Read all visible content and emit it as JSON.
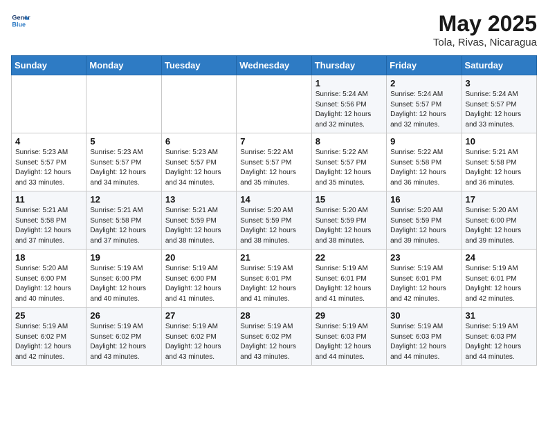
{
  "header": {
    "logo_line1": "General",
    "logo_line2": "Blue",
    "month": "May 2025",
    "location": "Tola, Rivas, Nicaragua"
  },
  "days_of_week": [
    "Sunday",
    "Monday",
    "Tuesday",
    "Wednesday",
    "Thursday",
    "Friday",
    "Saturday"
  ],
  "weeks": [
    [
      {
        "day": "",
        "info": ""
      },
      {
        "day": "",
        "info": ""
      },
      {
        "day": "",
        "info": ""
      },
      {
        "day": "",
        "info": ""
      },
      {
        "day": "1",
        "info": "Sunrise: 5:24 AM\nSunset: 5:56 PM\nDaylight: 12 hours\nand 32 minutes."
      },
      {
        "day": "2",
        "info": "Sunrise: 5:24 AM\nSunset: 5:57 PM\nDaylight: 12 hours\nand 32 minutes."
      },
      {
        "day": "3",
        "info": "Sunrise: 5:24 AM\nSunset: 5:57 PM\nDaylight: 12 hours\nand 33 minutes."
      }
    ],
    [
      {
        "day": "4",
        "info": "Sunrise: 5:23 AM\nSunset: 5:57 PM\nDaylight: 12 hours\nand 33 minutes."
      },
      {
        "day": "5",
        "info": "Sunrise: 5:23 AM\nSunset: 5:57 PM\nDaylight: 12 hours\nand 34 minutes."
      },
      {
        "day": "6",
        "info": "Sunrise: 5:23 AM\nSunset: 5:57 PM\nDaylight: 12 hours\nand 34 minutes."
      },
      {
        "day": "7",
        "info": "Sunrise: 5:22 AM\nSunset: 5:57 PM\nDaylight: 12 hours\nand 35 minutes."
      },
      {
        "day": "8",
        "info": "Sunrise: 5:22 AM\nSunset: 5:57 PM\nDaylight: 12 hours\nand 35 minutes."
      },
      {
        "day": "9",
        "info": "Sunrise: 5:22 AM\nSunset: 5:58 PM\nDaylight: 12 hours\nand 36 minutes."
      },
      {
        "day": "10",
        "info": "Sunrise: 5:21 AM\nSunset: 5:58 PM\nDaylight: 12 hours\nand 36 minutes."
      }
    ],
    [
      {
        "day": "11",
        "info": "Sunrise: 5:21 AM\nSunset: 5:58 PM\nDaylight: 12 hours\nand 37 minutes."
      },
      {
        "day": "12",
        "info": "Sunrise: 5:21 AM\nSunset: 5:58 PM\nDaylight: 12 hours\nand 37 minutes."
      },
      {
        "day": "13",
        "info": "Sunrise: 5:21 AM\nSunset: 5:59 PM\nDaylight: 12 hours\nand 38 minutes."
      },
      {
        "day": "14",
        "info": "Sunrise: 5:20 AM\nSunset: 5:59 PM\nDaylight: 12 hours\nand 38 minutes."
      },
      {
        "day": "15",
        "info": "Sunrise: 5:20 AM\nSunset: 5:59 PM\nDaylight: 12 hours\nand 38 minutes."
      },
      {
        "day": "16",
        "info": "Sunrise: 5:20 AM\nSunset: 5:59 PM\nDaylight: 12 hours\nand 39 minutes."
      },
      {
        "day": "17",
        "info": "Sunrise: 5:20 AM\nSunset: 6:00 PM\nDaylight: 12 hours\nand 39 minutes."
      }
    ],
    [
      {
        "day": "18",
        "info": "Sunrise: 5:20 AM\nSunset: 6:00 PM\nDaylight: 12 hours\nand 40 minutes."
      },
      {
        "day": "19",
        "info": "Sunrise: 5:19 AM\nSunset: 6:00 PM\nDaylight: 12 hours\nand 40 minutes."
      },
      {
        "day": "20",
        "info": "Sunrise: 5:19 AM\nSunset: 6:00 PM\nDaylight: 12 hours\nand 41 minutes."
      },
      {
        "day": "21",
        "info": "Sunrise: 5:19 AM\nSunset: 6:01 PM\nDaylight: 12 hours\nand 41 minutes."
      },
      {
        "day": "22",
        "info": "Sunrise: 5:19 AM\nSunset: 6:01 PM\nDaylight: 12 hours\nand 41 minutes."
      },
      {
        "day": "23",
        "info": "Sunrise: 5:19 AM\nSunset: 6:01 PM\nDaylight: 12 hours\nand 42 minutes."
      },
      {
        "day": "24",
        "info": "Sunrise: 5:19 AM\nSunset: 6:01 PM\nDaylight: 12 hours\nand 42 minutes."
      }
    ],
    [
      {
        "day": "25",
        "info": "Sunrise: 5:19 AM\nSunset: 6:02 PM\nDaylight: 12 hours\nand 42 minutes."
      },
      {
        "day": "26",
        "info": "Sunrise: 5:19 AM\nSunset: 6:02 PM\nDaylight: 12 hours\nand 43 minutes."
      },
      {
        "day": "27",
        "info": "Sunrise: 5:19 AM\nSunset: 6:02 PM\nDaylight: 12 hours\nand 43 minutes."
      },
      {
        "day": "28",
        "info": "Sunrise: 5:19 AM\nSunset: 6:02 PM\nDaylight: 12 hours\nand 43 minutes."
      },
      {
        "day": "29",
        "info": "Sunrise: 5:19 AM\nSunset: 6:03 PM\nDaylight: 12 hours\nand 44 minutes."
      },
      {
        "day": "30",
        "info": "Sunrise: 5:19 AM\nSunset: 6:03 PM\nDaylight: 12 hours\nand 44 minutes."
      },
      {
        "day": "31",
        "info": "Sunrise: 5:19 AM\nSunset: 6:03 PM\nDaylight: 12 hours\nand 44 minutes."
      }
    ]
  ]
}
